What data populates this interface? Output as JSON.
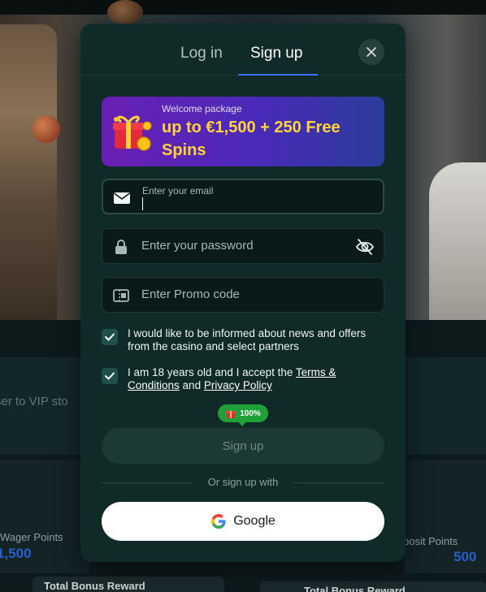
{
  "background": {
    "vip_text": "ser to VIP sto",
    "wager_label": "Wager Points",
    "wager_value": "1,500",
    "deposit_label": "posit Points",
    "deposit_value": "500",
    "bonus_left": "Total Bonus Reward",
    "bonus_right": "Total Bonus Reward"
  },
  "modal": {
    "tabs": [
      {
        "label": "Log in",
        "active": false
      },
      {
        "label": "Sign up",
        "active": true
      }
    ],
    "close_icon": "close-icon",
    "welcome": {
      "label": "Welcome package",
      "title": "up to €1,500 + 250 Free Spins",
      "icon": "gift-icon"
    },
    "email": {
      "label": "Enter your email",
      "value": "",
      "icon": "envelope-icon"
    },
    "password": {
      "placeholder": "Enter your password",
      "icon": "lock-icon",
      "toggle_icon": "eye-off-icon"
    },
    "promo": {
      "placeholder": "Enter Promo code",
      "icon": "ticket-icon"
    },
    "checkboxes": [
      {
        "checked": true,
        "text": "I would like to be informed about news and offers from the casino and select partners"
      },
      {
        "checked": true,
        "text_before": "I am 18 years old and I accept the ",
        "link1": "Terms & Conditions",
        "text_mid": " and ",
        "link2": "Privacy Policy"
      }
    ],
    "bonus_badge": {
      "text": "100%",
      "icon": "gift-icon"
    },
    "submit_label": "Sign up",
    "divider_text": "Or sign up with",
    "google_label": "Google",
    "colors": {
      "modal_bg": "#0f2a27",
      "accent_tab": "#3a72ff",
      "welcome_text": "#ffd43a",
      "badge": "#1fa038"
    }
  }
}
